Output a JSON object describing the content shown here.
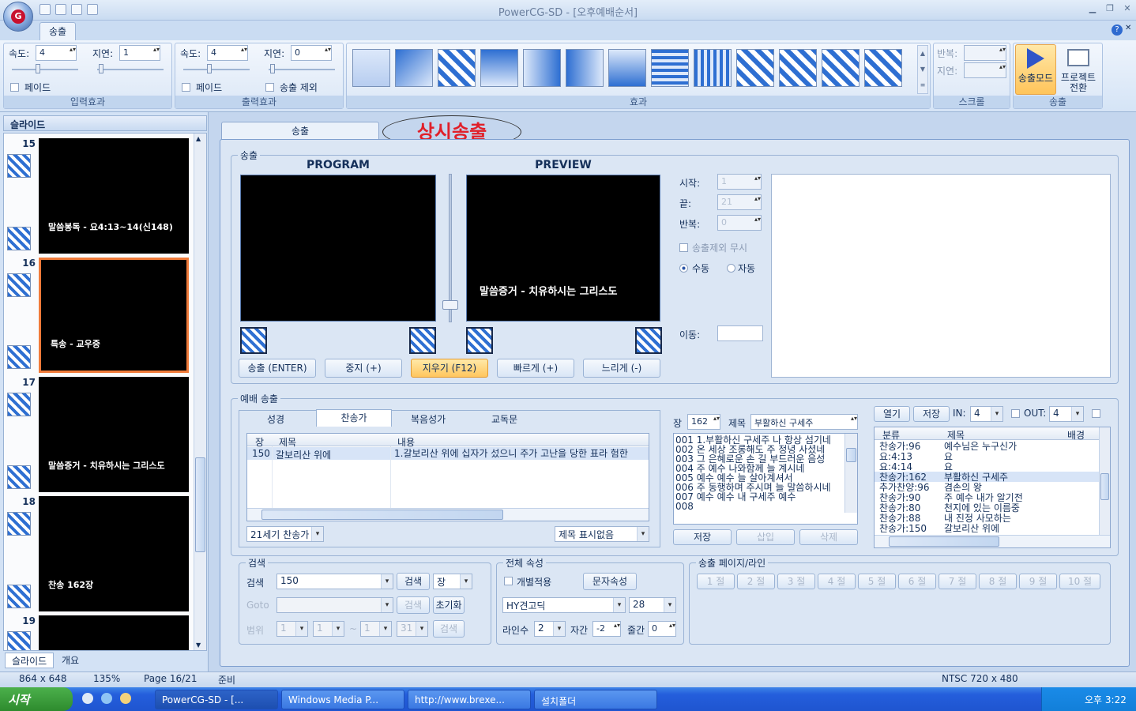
{
  "window": {
    "title": "PowerCG-SD - [오후예배순서]"
  },
  "ribbon": {
    "tab": "송출",
    "input_effect": {
      "speed_label": "속도:",
      "speed_value": "4",
      "delay_label": "지연:",
      "delay_value": "1",
      "fade_label": "페이드",
      "caption": "입력효과"
    },
    "output_effect": {
      "speed_label": "속도:",
      "speed_value": "4",
      "delay_label": "지연:",
      "delay_value": "0",
      "fade_label": "페이드",
      "exclude_label": "송출 제외",
      "caption": "출력효과"
    },
    "effects_caption": "효과",
    "scroll": {
      "repeat_label": "반복:",
      "delay_label": "지연:",
      "caption": "스크롤"
    },
    "broadcast": {
      "mode_label": "송출모드",
      "project_label": "프로젝트 전환",
      "caption": "송출"
    }
  },
  "slides_panel": {
    "title": "슬라이드",
    "slides": [
      {
        "num": "15",
        "title": "말씀봉독 - 요4:13~14(신148)"
      },
      {
        "num": "16",
        "title": "특송 - 교우중"
      },
      {
        "num": "17",
        "title": "말씀증거 - 치유하시는 그리스도"
      },
      {
        "num": "18",
        "title": "찬송 162장"
      },
      {
        "num": "19",
        "title": ""
      }
    ],
    "tabs": [
      "슬라이드",
      "개요"
    ]
  },
  "main": {
    "tab": "송출",
    "annotation": "상시송출",
    "broadcast_group": "송출",
    "program_label": "PROGRAM",
    "preview_label": "PREVIEW",
    "preview_text": "말씀증거 - 치유하시는 그리스도",
    "buttons": {
      "send": "송출 (ENTER)",
      "stop": "중지 (+)",
      "clear": "지우기 (F12)",
      "faster": "빠르게 (+)",
      "slower": "느리게 (-)"
    },
    "start_label": "시작:",
    "start_value": "1",
    "end_label": "끝:",
    "end_value": "21",
    "repeat_label": "반복:",
    "repeat_value": "0",
    "ignore_exclude": "송출제외 무시",
    "manual": "수동",
    "auto": "자동",
    "move_label": "이동:"
  },
  "worship": {
    "group": "예배 송출",
    "tabs": [
      "성경",
      "찬송가",
      "복음성가",
      "교독문"
    ],
    "grid_headers": [
      "장",
      "제목",
      "내용"
    ],
    "grid_row": {
      "num": "150",
      "title": "갈보리산 위에",
      "content": "1.갈보리산 위에 십자가 섰으니  주가 고난을 당한 표라  험한"
    },
    "hymnal_combo": "21세기 찬송가",
    "title_display_combo": "제목 표시없음",
    "chapter_label": "장",
    "chapter_value": "162",
    "title_label": "제목",
    "title_value": "부활하신 구세주",
    "lyrics": [
      "001 1.부활하신 구세주 나 항상 섬기네",
      "002 온 세상 조롱해도 주 정녕 사셨네",
      "003 그 은혜로운 손 길 부드러운 음성",
      "004 주 예수 나와함께 늘 계시네",
      "005 예수 예수 늘 살아계셔서",
      "006 주 동행하며 주시며 늘 말씀하시네",
      "007 예수 예수 내 구세주 예수",
      "008"
    ],
    "save": "저장",
    "insert": "삽입",
    "delete": "삭제",
    "open": "열기",
    "save2": "저장",
    "in_label": "IN:",
    "in_value": "4",
    "out_label": "OUT:",
    "out_value": "4",
    "list_headers": [
      "분류",
      "제목",
      "배경"
    ],
    "list_rows": [
      {
        "cat": "찬송가:96",
        "title": "예수님은 누구신가"
      },
      {
        "cat": "요:4:13",
        "title": "요"
      },
      {
        "cat": "요:4:14",
        "title": "요"
      },
      {
        "cat": "찬송가:162",
        "title": "부활하신 구세주"
      },
      {
        "cat": "추가찬양:96",
        "title": "겸손의 왕"
      },
      {
        "cat": "찬송가:90",
        "title": "주 예수 내가 알기전"
      },
      {
        "cat": "찬송가:80",
        "title": "천지에 있는 이름중"
      },
      {
        "cat": "찬송가:88",
        "title": "내 진정 사모하는"
      },
      {
        "cat": "찬송가:150",
        "title": "갈보리산 위에"
      }
    ]
  },
  "search": {
    "group": "검색",
    "search_label": "검색",
    "search_value": "150",
    "search_btn": "검색",
    "unit_combo": "장",
    "goto_label": "Goto",
    "goto_btn": "검색",
    "reset_btn": "초기화",
    "range_label": "범위",
    "range_values": [
      "1",
      "1",
      "1",
      "31"
    ],
    "range_sep": "~",
    "range_btn": "검색"
  },
  "props": {
    "group": "전체 속성",
    "individual": "개별적용",
    "char_btn": "문자속성",
    "font": "HY견고딕",
    "size": "28",
    "lines_label": "라인수",
    "lines_value": "2",
    "spacing_label": "자간",
    "spacing_value": "-2",
    "linegap_label": "줄간",
    "linegap_value": "0"
  },
  "pages": {
    "group": "송출 페이지/라인",
    "verses": [
      "1 절",
      "2 절",
      "3 절",
      "4 절",
      "5 절",
      "6 절",
      "7 절",
      "8 절",
      "9 절",
      "10 절"
    ]
  },
  "status": {
    "size": "864 x 648",
    "zoom": "135%",
    "page": "Page 16/21",
    "state": "준비",
    "format": "NTSC 720 x 480"
  },
  "taskbar": {
    "start": "시작",
    "tasks": [
      "PowerCG-SD - [...",
      "Windows Media P...",
      "http://www.brexe...",
      "설치폴더"
    ],
    "clock": "오후 3:22"
  }
}
